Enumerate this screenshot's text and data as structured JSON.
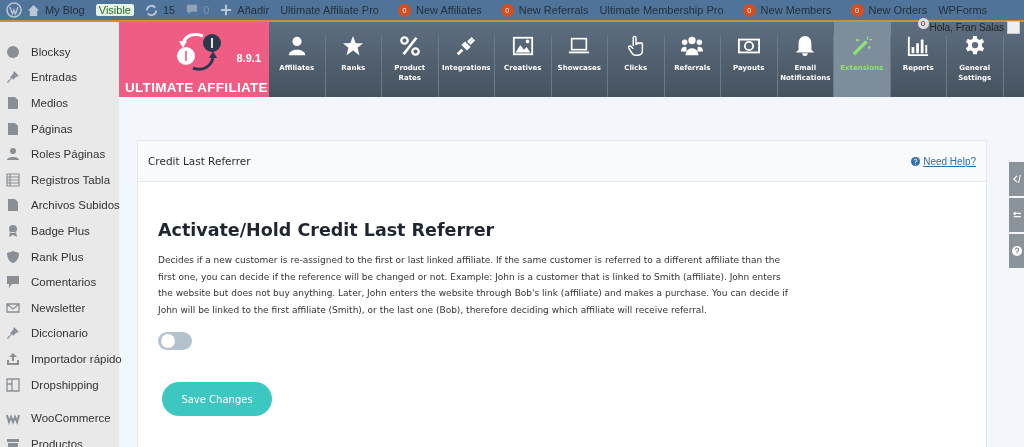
{
  "admin_bar": {
    "site": "My Blog",
    "visibility": "Visible",
    "updates": "15",
    "comments": "0",
    "add": "Añadir",
    "links": [
      {
        "label": "Ultimate Affiliate Pro"
      },
      {
        "label": "New Affiliates",
        "badge": "0"
      },
      {
        "label": "New Referrals",
        "badge": "0"
      },
      {
        "label": "Ultimate Membership Pro"
      },
      {
        "label": "New Members",
        "badge": "0"
      },
      {
        "label": "New Orders",
        "badge": "0"
      },
      {
        "label": "WPForms"
      }
    ]
  },
  "user": {
    "greeting": "Hola, Fran Salas",
    "notifications": "0"
  },
  "sidebar": {
    "items": [
      {
        "label": "Blocksy"
      },
      {
        "label": "Entradas"
      },
      {
        "label": "Medios"
      },
      {
        "label": "Páginas"
      },
      {
        "label": "Roles Páginas"
      },
      {
        "label": "Registros Tabla"
      },
      {
        "label": "Archivos Subidos"
      },
      {
        "label": "Badge Plus"
      },
      {
        "label": "Rank Plus"
      },
      {
        "label": "Comentarios"
      },
      {
        "label": "Newsletter"
      },
      {
        "label": "Diccionario"
      },
      {
        "label": "Importador rápido"
      },
      {
        "label": "Dropshipping"
      },
      {
        "label": "WooCommerce"
      },
      {
        "label": "Productos"
      }
    ]
  },
  "plugin": {
    "logo_text": "ULTIMATE AFFILIATE",
    "version": "8.9.1",
    "nav": [
      {
        "label": "Affiliates",
        "selected": false
      },
      {
        "label": "Ranks",
        "selected": false
      },
      {
        "label": "Product Rates",
        "selected": false
      },
      {
        "label": "Integrations",
        "selected": false
      },
      {
        "label": "Creatives",
        "selected": false
      },
      {
        "label": "Showcases",
        "selected": false
      },
      {
        "label": "Clicks",
        "selected": false
      },
      {
        "label": "Referrals",
        "selected": false
      },
      {
        "label": "Payouts",
        "selected": false
      },
      {
        "label": "Email Notifications",
        "selected": false
      },
      {
        "label": "Extensions",
        "selected": true
      },
      {
        "label": "Reports",
        "selected": false
      },
      {
        "label": "General Settings",
        "selected": false
      }
    ]
  },
  "card": {
    "title": "Credit Last Referrer",
    "help": "Need Help?",
    "heading": "Activate/Hold Credit Last Referrer",
    "description": "Decides if a new customer is re-assigned to the first or last linked affiliate. If the same customer is referred to a different affiliate than the first one, you can decide if the reference will be changed or not. Example: John is a customer that is linked to Smith (affiliate). John enters the website but does not buy anything. Later, John enters the website through Bob's link (affiliate) and makes a purchase. You can decide if John will be linked to the first affiliate (Smith), or the last one (Bob), therefore deciding which affiliate will receive referral.",
    "toggle": {
      "on": false
    },
    "button": "Save Changes"
  }
}
